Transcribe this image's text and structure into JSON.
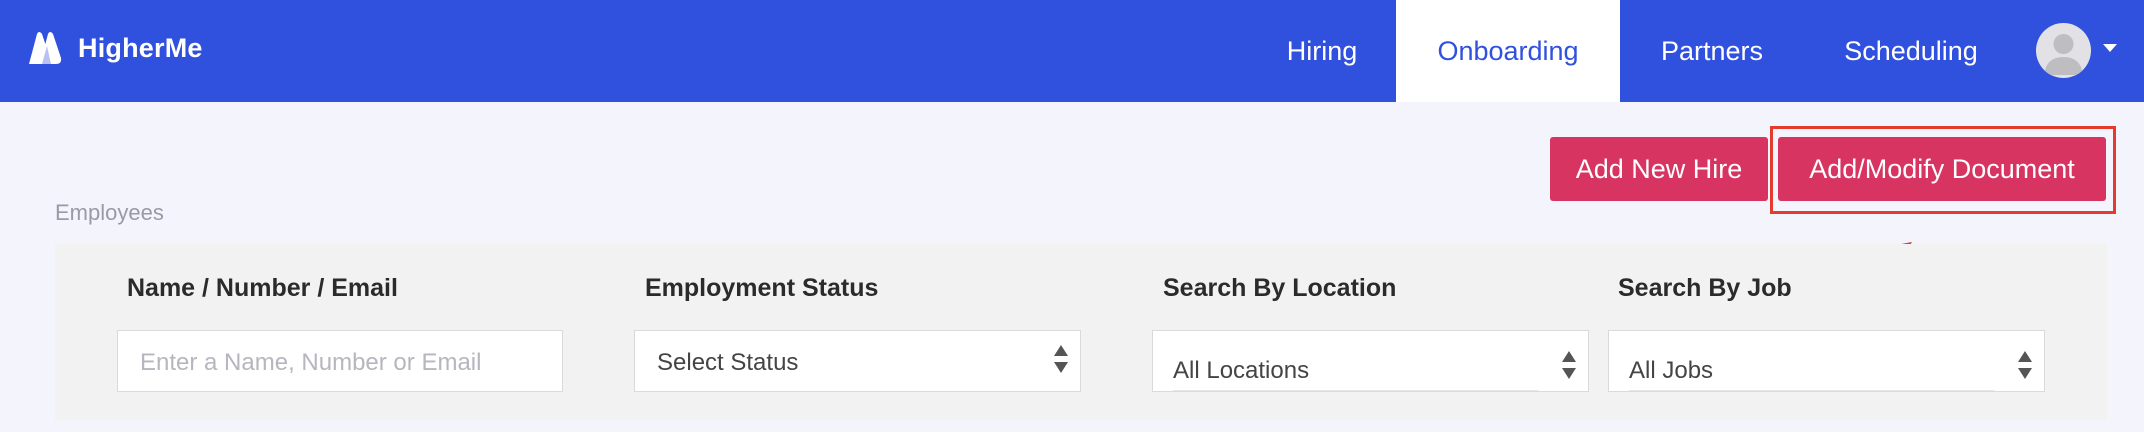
{
  "brand": {
    "name": "HigherMe",
    "color": "#3050de"
  },
  "nav": {
    "items": [
      {
        "label": "Hiring",
        "active": false
      },
      {
        "label": "Onboarding",
        "active": true
      },
      {
        "label": "Partners",
        "active": false
      },
      {
        "label": "Scheduling",
        "active": false
      }
    ],
    "avatar_icon": "user-avatar-icon",
    "menu_icon": "caret-down-icon"
  },
  "actions": {
    "add_new_hire": "Add New Hire",
    "add_modify_document": "Add/Modify Document",
    "button_color": "#d83461",
    "highlight_color": "#e53b2c"
  },
  "employees": {
    "section_label": "Employees",
    "filters": {
      "name": {
        "label": "Name / Number / Email",
        "placeholder": "Enter a Name, Number or Email",
        "value": ""
      },
      "status": {
        "label": "Employment Status",
        "value": "Select Status"
      },
      "location": {
        "label": "Search By Location",
        "value": "All Locations"
      },
      "job": {
        "label": "Search By Job",
        "value": "All Jobs"
      }
    }
  }
}
